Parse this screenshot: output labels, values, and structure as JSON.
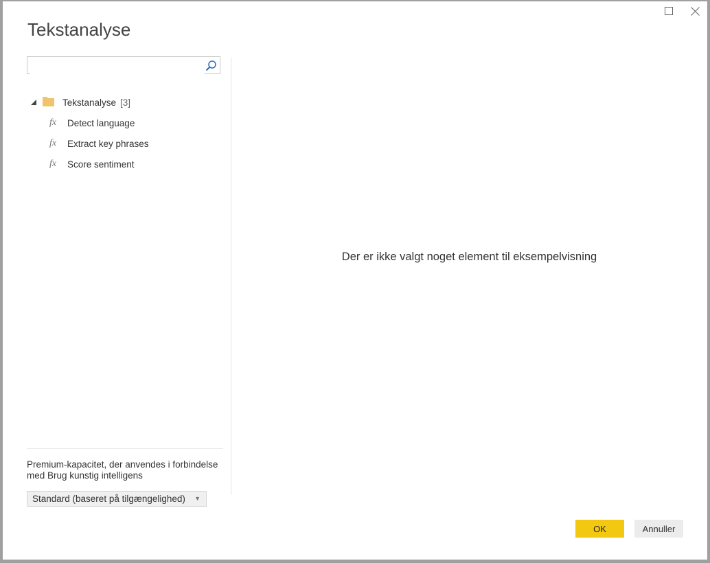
{
  "dialog": {
    "title": "Tekstanalyse",
    "window_controls": [
      "maximize",
      "close"
    ]
  },
  "search": {
    "value": "",
    "placeholder": "",
    "icon": "search-icon"
  },
  "tree": {
    "folder": {
      "label": "Tekstanalyse",
      "count": "[3]",
      "expanded": true,
      "icon": "folder-icon",
      "folder_color": "#f0c46c"
    },
    "items": [
      {
        "label": "Detect language",
        "icon": "function-icon",
        "glyph": "fx"
      },
      {
        "label": "Extract key phrases",
        "icon": "function-icon",
        "glyph": "fx"
      },
      {
        "label": "Score sentiment",
        "icon": "function-icon",
        "glyph": "fx"
      }
    ]
  },
  "preview": {
    "empty_message": "Der er ikke valgt noget element til eksempelvisning"
  },
  "capacity": {
    "label": "Premium-kapacitet, der anvendes i forbindelse med Brug kunstig intelligens",
    "selected": "Standard (baseret på tilgængelighed)"
  },
  "buttons": {
    "ok": "OK",
    "cancel": "Annuller",
    "ok_color": "#f2c811"
  }
}
